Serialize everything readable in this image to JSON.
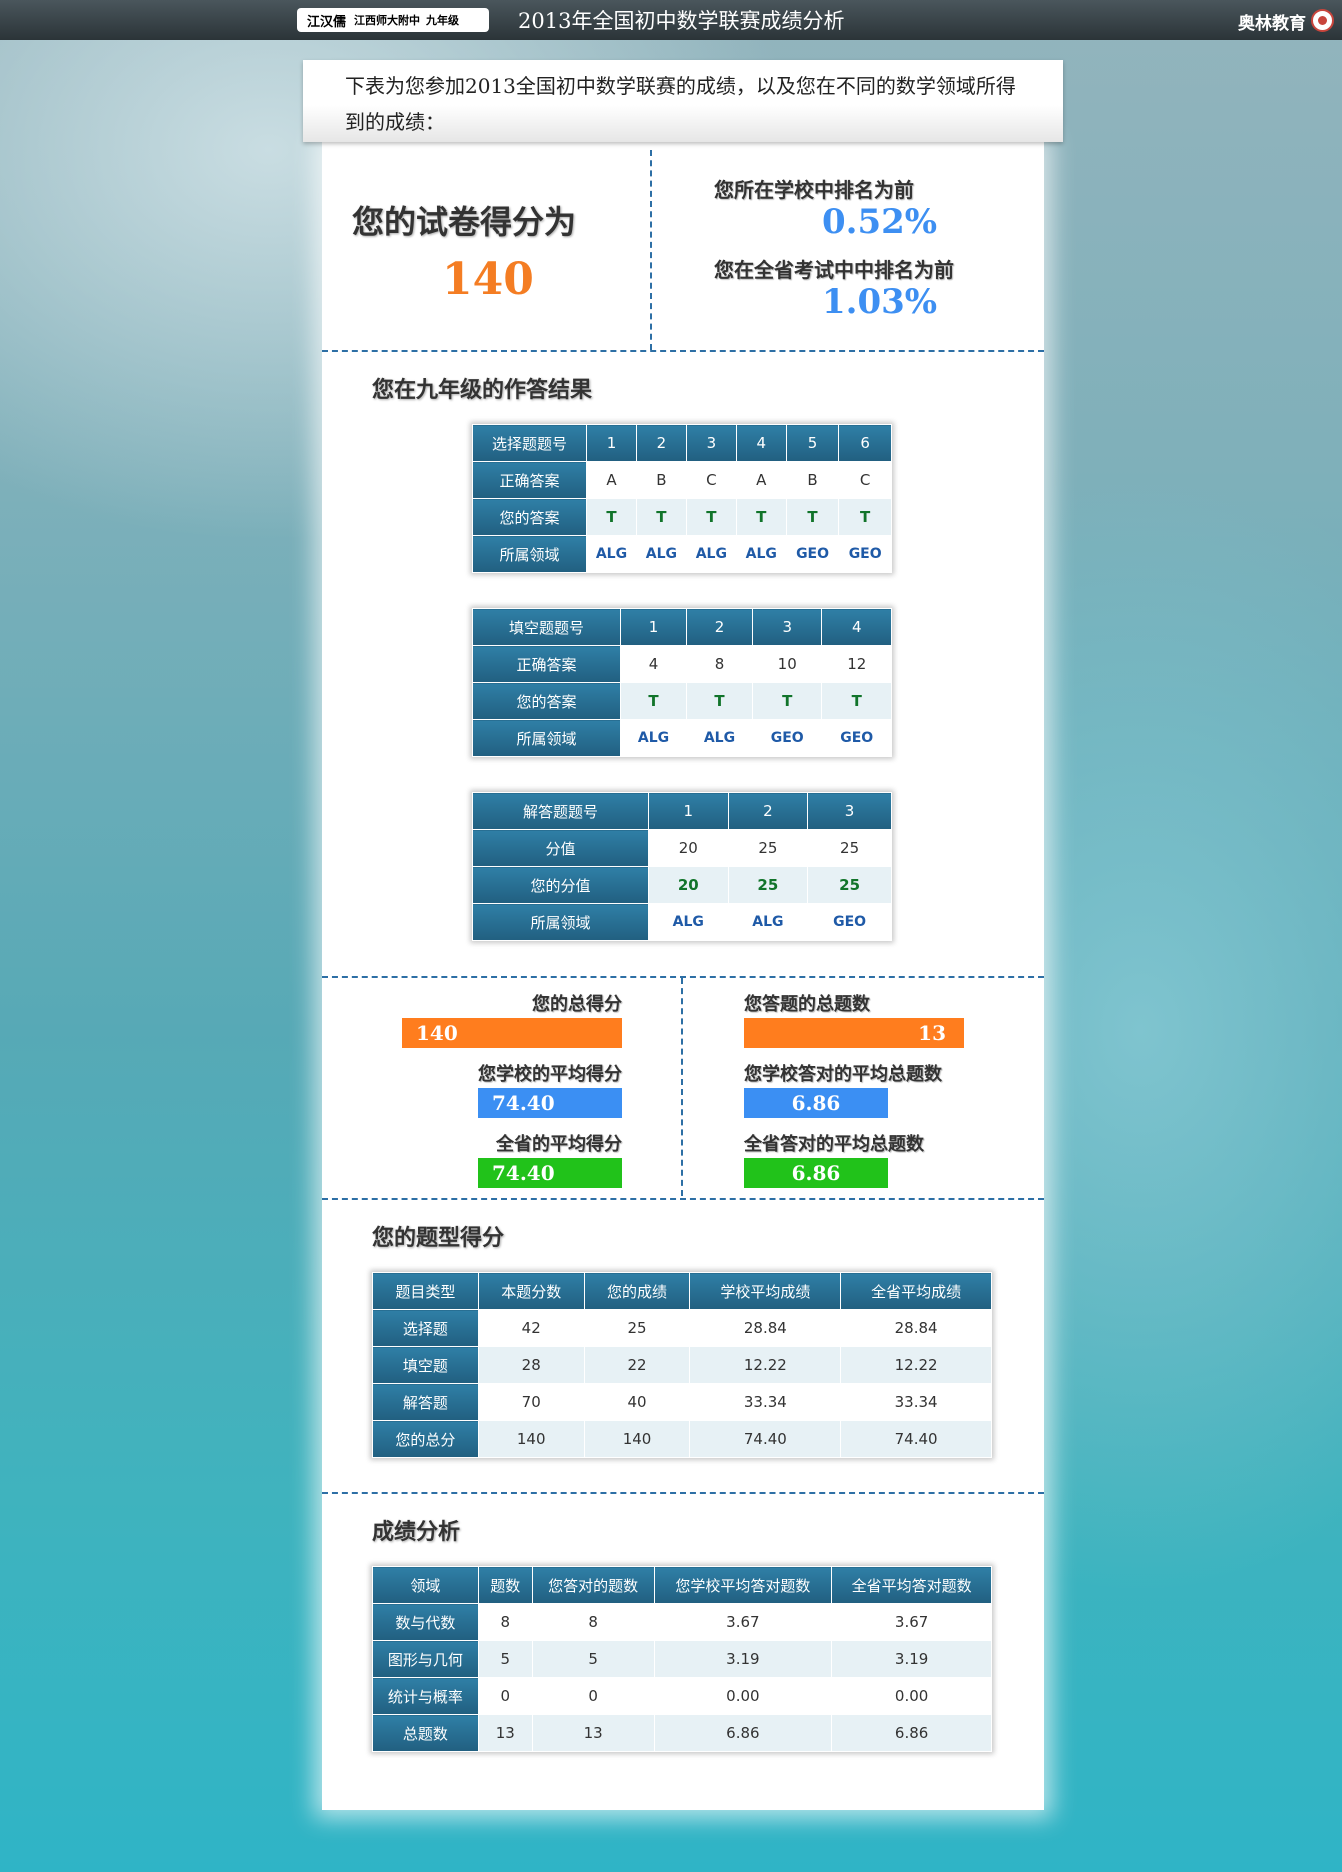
{
  "header": {
    "tag_name": "江汉儒",
    "tag_school": "江西师大附中",
    "tag_grade": "九年级",
    "title": "2013年全国初中数学联赛成绩分析",
    "brand": "奥林教育"
  },
  "intro": "下表为您参加2013全国初中数学联赛的成绩，以及您在不同的数学领域所得到的成绩：",
  "score": {
    "label": "您的试卷得分为",
    "value": "140",
    "school_rank_label": "您所在学校中排名为前",
    "school_rank": "0.52%",
    "province_rank_label": "您在全省考试中中排名为前",
    "province_rank": "1.03%"
  },
  "answers_title": "您在九年级的作答结果",
  "row_labels": {
    "correct": "正确答案",
    "yours": "您的答案",
    "domain": "所属领域",
    "full": "分值",
    "your_score": "您的分值"
  },
  "choice": {
    "header": "选择题题号",
    "nums": [
      "1",
      "2",
      "3",
      "4",
      "5",
      "6"
    ],
    "correct": [
      "A",
      "B",
      "C",
      "A",
      "B",
      "C"
    ],
    "yours": [
      "T",
      "T",
      "T",
      "T",
      "T",
      "T"
    ],
    "domain": [
      "ALG",
      "ALG",
      "ALG",
      "ALG",
      "GEO",
      "GEO"
    ]
  },
  "fill": {
    "header": "填空题题号",
    "nums": [
      "1",
      "2",
      "3",
      "4"
    ],
    "correct": [
      "4",
      "8",
      "10",
      "12"
    ],
    "yours": [
      "T",
      "T",
      "T",
      "T"
    ],
    "domain": [
      "ALG",
      "ALG",
      "GEO",
      "GEO"
    ]
  },
  "solve": {
    "header": "解答题题号",
    "nums": [
      "1",
      "2",
      "3"
    ],
    "full": [
      "20",
      "25",
      "25"
    ],
    "yours": [
      "20",
      "25",
      "25"
    ],
    "domain": [
      "ALG",
      "ALG",
      "GEO"
    ]
  },
  "summary": {
    "total_label": "您的总得分",
    "total": "140",
    "school_avg_label": "您学校的平均得分",
    "school_avg": "74.40",
    "province_avg_label": "全省的平均得分",
    "province_avg": "74.40",
    "count_label": "您答题的总题数",
    "count": "13",
    "school_count_label": "您学校答对的平均总题数",
    "school_count": "6.86",
    "province_count_label": "全省答对的平均总题数",
    "province_count": "6.86"
  },
  "types": {
    "title": "您的题型得分",
    "headers": [
      "题目类型",
      "本题分数",
      "您的成绩",
      "学校平均成绩",
      "全省平均成绩"
    ],
    "rows": [
      [
        "选择题",
        "42",
        "25",
        "28.84",
        "28.84"
      ],
      [
        "填空题",
        "28",
        "22",
        "12.22",
        "12.22"
      ],
      [
        "解答题",
        "70",
        "40",
        "33.34",
        "33.34"
      ],
      [
        "您的总分",
        "140",
        "140",
        "74.40",
        "74.40"
      ]
    ]
  },
  "analysis": {
    "title": "成绩分析",
    "headers": [
      "领域",
      "题数",
      "您答对的题数",
      "您学校平均答对题数",
      "全省平均答对题数"
    ],
    "rows": [
      [
        "数与代数",
        "8",
        "8",
        "3.67",
        "3.67"
      ],
      [
        "图形与几何",
        "5",
        "5",
        "3.19",
        "3.19"
      ],
      [
        "统计与概率",
        "0",
        "0",
        "0.00",
        "0.00"
      ],
      [
        "总题数",
        "13",
        "13",
        "6.86",
        "6.86"
      ]
    ]
  },
  "colors": {
    "orange": "#ff7d1e",
    "blue": "#3b8ff3",
    "green": "#21c21a",
    "table_header": "#2a7296"
  }
}
